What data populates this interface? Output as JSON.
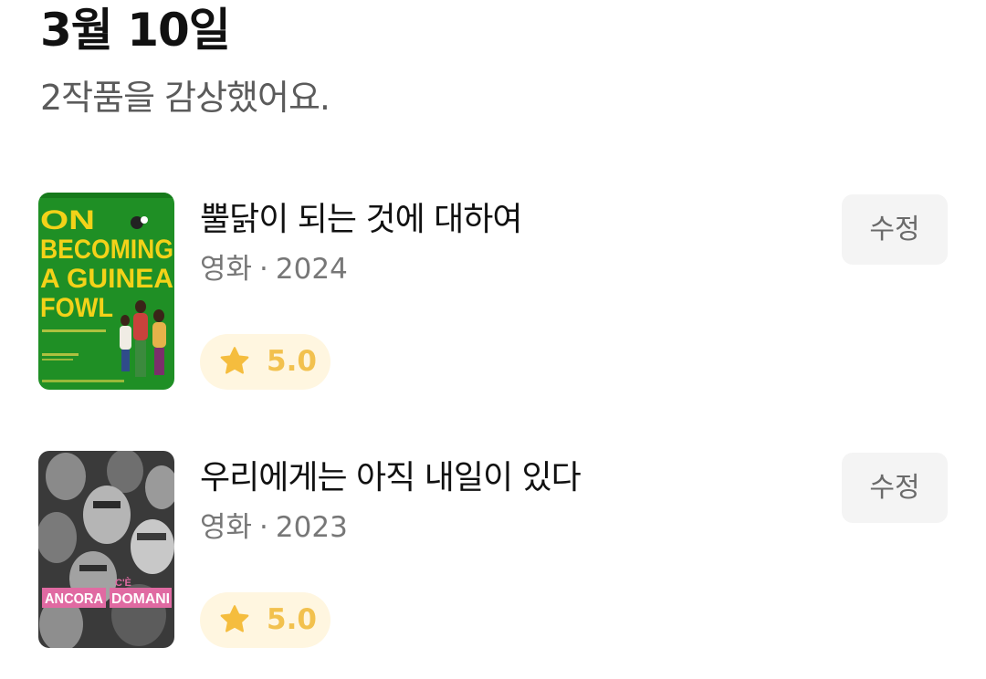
{
  "header": {
    "date": "3월 10일",
    "summary": "2작품을 감상했어요."
  },
  "colors": {
    "rating_pill_bg": "#fff6e0",
    "star": "#f5bd3e",
    "edit_button_bg": "#f4f4f4"
  },
  "items": [
    {
      "poster": {
        "description_icon": "movie-poster",
        "lines": [
          "ON",
          "BECOMING",
          "A GUINEA",
          "FOWL"
        ],
        "bg_color": "#1f8f25",
        "text_color": "#f3d219"
      },
      "title": "뿔닭이 되는 것에 대하여",
      "type": "영화",
      "separator": "·",
      "year": "2024",
      "rating": "5.0",
      "edit_label": "수정"
    },
    {
      "poster": {
        "description_icon": "movie-poster",
        "label_left": "ANCORA",
        "label_small": "C'È",
        "label_right": "DOMANI",
        "label_color": "#e06aa2"
      },
      "title": "우리에게는 아직 내일이 있다",
      "type": "영화",
      "separator": "·",
      "year": "2023",
      "rating": "5.0",
      "edit_label": "수정"
    }
  ]
}
